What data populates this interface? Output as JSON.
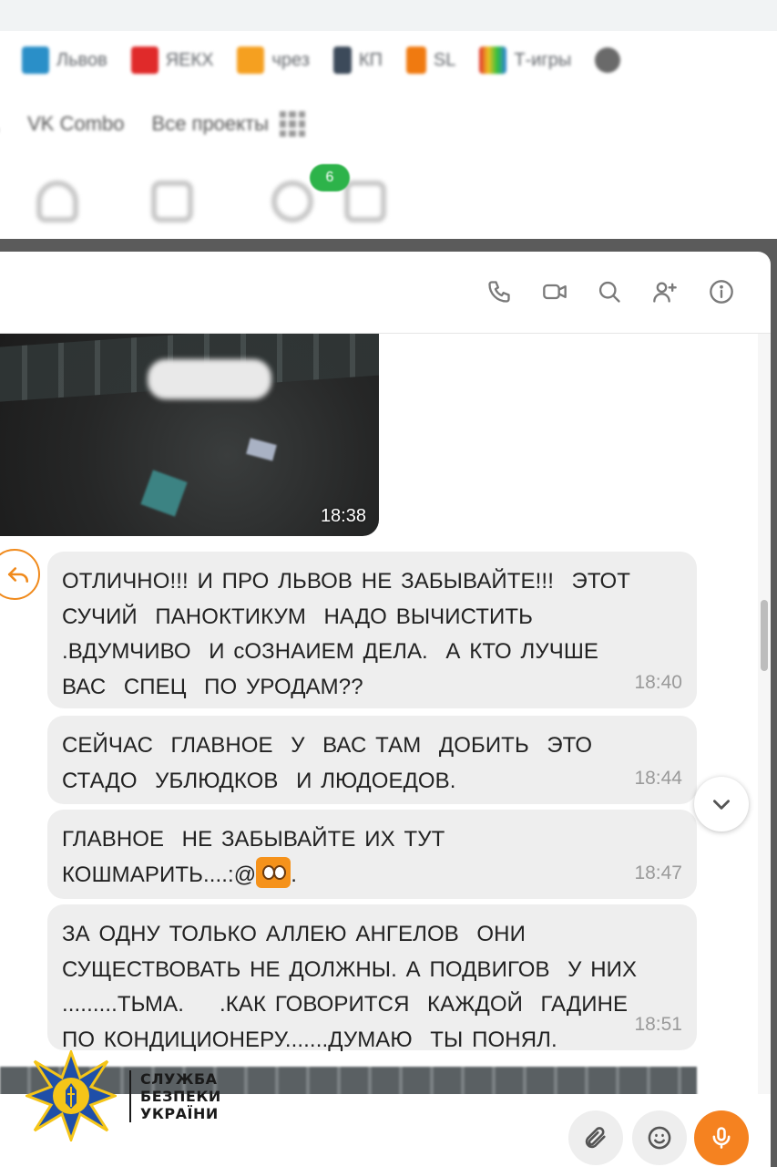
{
  "browser": {
    "bookmarks": [
      {
        "label": "Львов",
        "color": "#2a8fc8"
      },
      {
        "label": "ЯЕКХ",
        "color": "#e02a2a"
      },
      {
        "label": "чрез",
        "color": "#f5a020"
      },
      {
        "label": "КП",
        "color": "#3c4a5a"
      },
      {
        "label": "SL",
        "color": "#f07a10"
      },
      {
        "label": "Т-игры",
        "color": "#f0c020"
      }
    ],
    "toolbar_links": [
      "VK Combo",
      "Все проекты"
    ],
    "notification_count": "6"
  },
  "chat": {
    "header_icons": [
      "phone-icon",
      "video-icon",
      "search-icon",
      "add-user-icon",
      "info-icon"
    ],
    "photo": {
      "time": "18:38",
      "blurred_caption": "!!! !!!!"
    },
    "messages": [
      {
        "text": "ОТЛИЧНО!!! И ПРО ЛЬВОВ НЕ ЗАБЫВАЙТЕ!!!  ЭТОТ\nСУЧИЙ  ПАНОКТИКУМ  НАДО ВЫЧИСТИТЬ\n.ВДУМЧИВО  И сОЗНАИЕМ ДЕЛА.  А КТО ЛУЧШЕ\nВАС  СПЕЦ  ПО УРОДАМ??",
        "time": "18:40"
      },
      {
        "text": "СЕЙЧАС  ГЛАВНОЕ  У  ВАС ТАМ  ДОБИТЬ  ЭТО\nСТАДО  УБЛЮДКОВ  И ЛЮДОЕДОВ.",
        "time": "18:44"
      },
      {
        "text_before": "ГЛАВНОЕ  НЕ ЗАБЫВАЙТЕ ИХ ТУТ\nКОШМАРИТЬ....:@",
        "text_after": ".",
        "time": "18:47"
      },
      {
        "text": "ЗА ОДНУ ТОЛЬКО АЛЛЕЮ АНГЕЛОВ  ОНИ\nСУЩЕСТВОВАТЬ НЕ ДОЛЖНЫ. А ПОДВИГОВ  У НИХ\n.........ТЬМА.    .КАК ГОВОРИТСЯ  КАЖДОЙ  ГАДИНЕ\nПО КОНДИЦИОНЕРУ.......ДУМАЮ  ТЫ ПОНЯЛ.",
        "time": "18:51"
      }
    ],
    "accent_color": "#f58220"
  },
  "watermark": {
    "lines": [
      "СЛУЖБА",
      "БЕЗПЕКИ",
      "УКРАЇНИ"
    ]
  }
}
